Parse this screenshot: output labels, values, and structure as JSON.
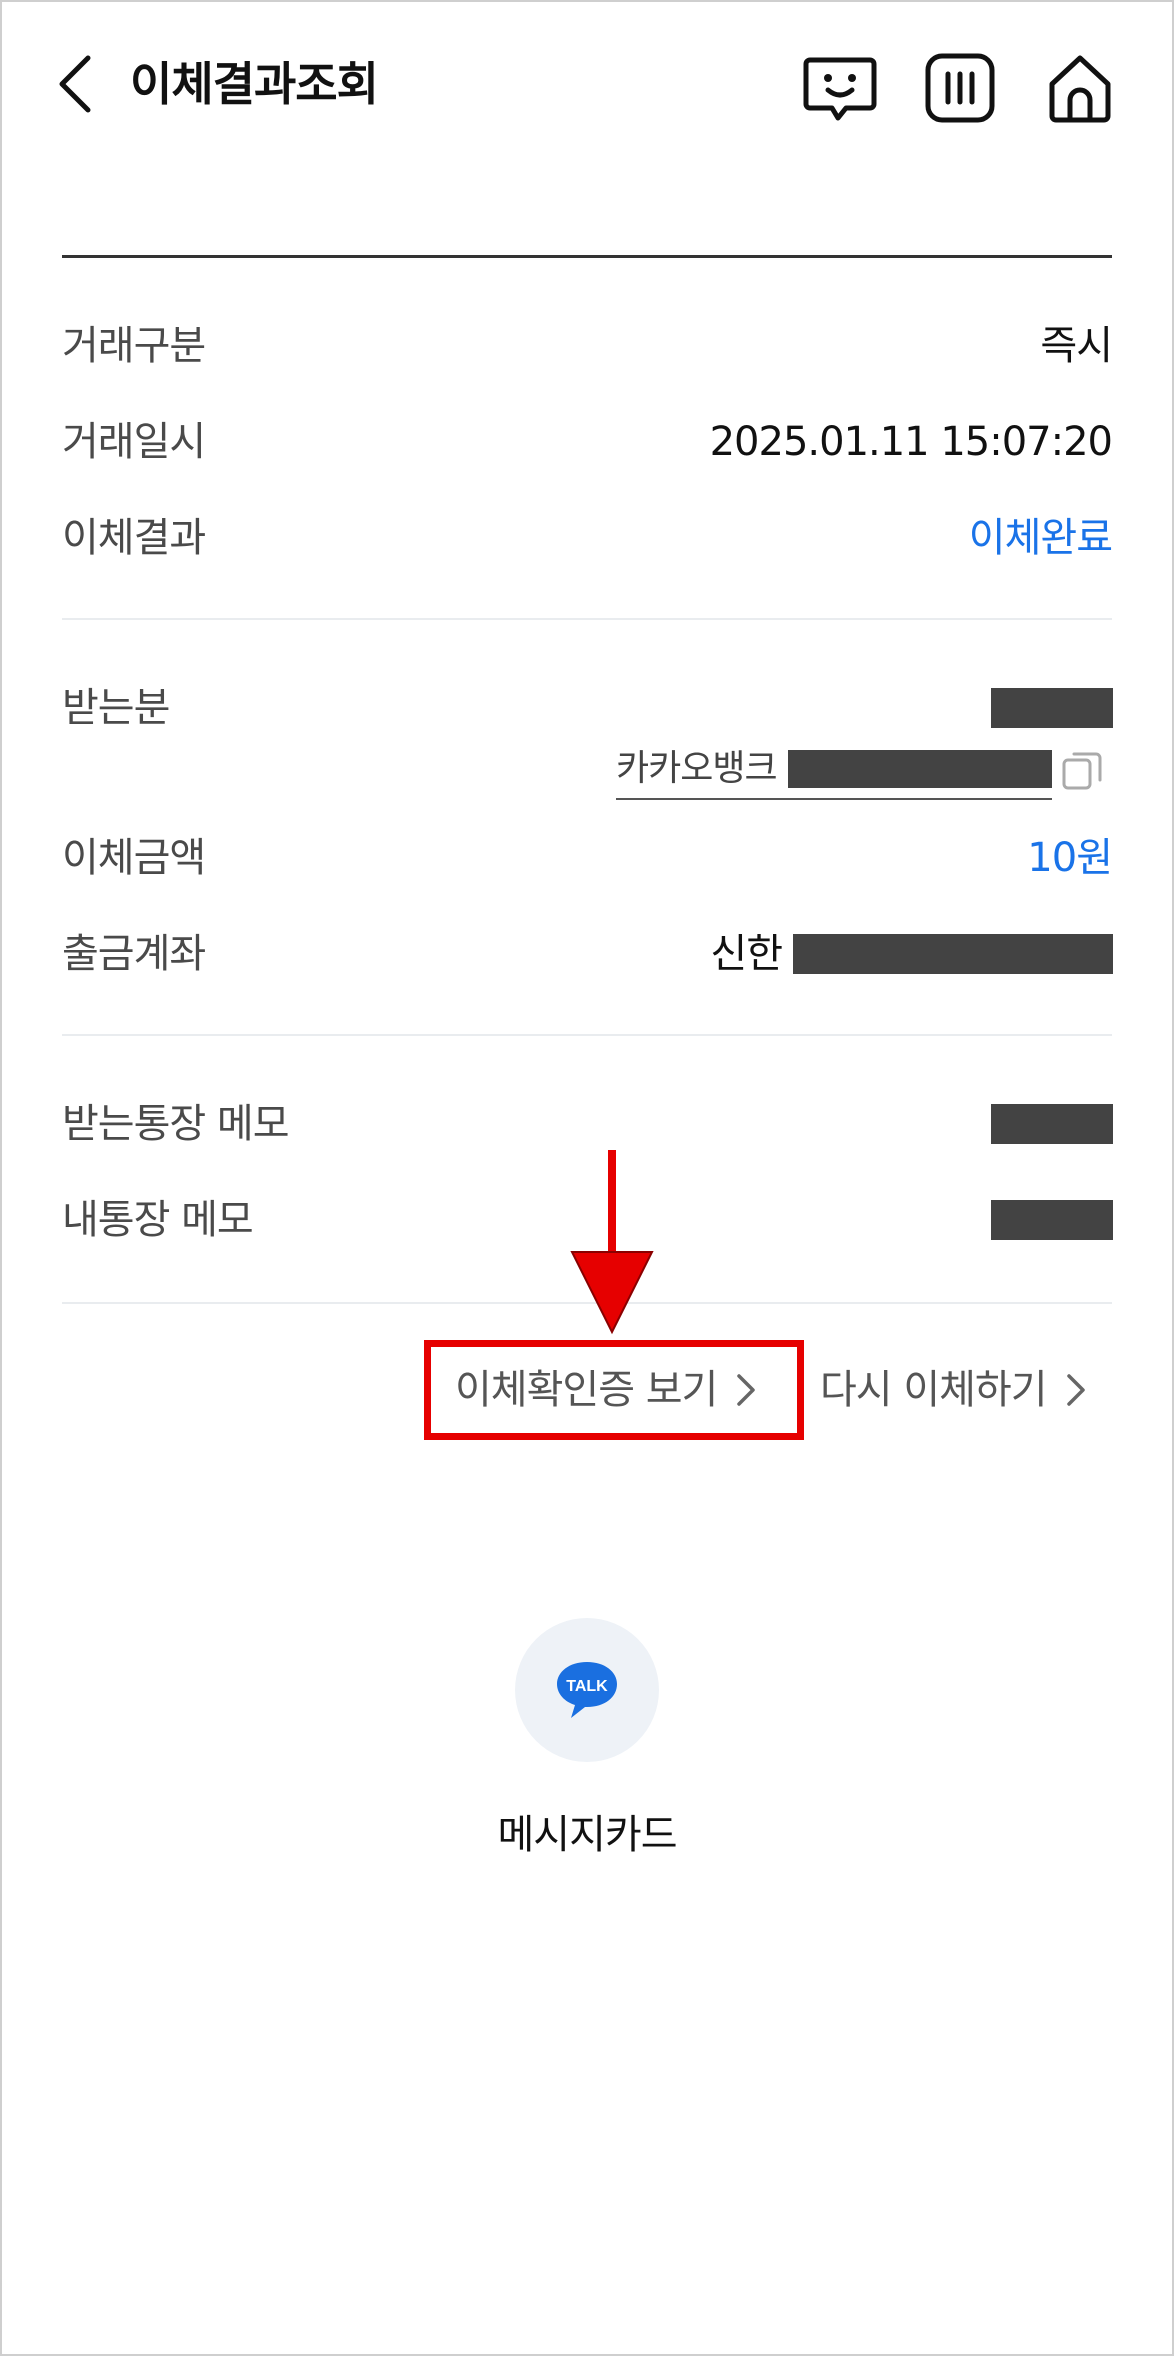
{
  "header": {
    "title": "이체결과조회",
    "icons": [
      "back-icon",
      "chat-bot-icon",
      "menu-icon",
      "home-icon"
    ]
  },
  "transaction": {
    "type_label": "거래구분",
    "type_value": "즉시",
    "datetime_label": "거래일시",
    "datetime_value": "2025.01.11 15:07:20",
    "result_label": "이체결과",
    "result_value": "이체완료"
  },
  "recipient": {
    "label": "받는분",
    "bank": "카카오뱅크",
    "amount_label": "이체금액",
    "amount_value": "10원",
    "from_account_label": "출금계좌",
    "from_bank": "신한"
  },
  "memo": {
    "recipient_memo_label": "받는통장 메모",
    "my_memo_label": "내통장 메모"
  },
  "actions": {
    "verify_label": "이체확인증 보기",
    "retransfer_label": "다시 이체하기"
  },
  "share": {
    "talk_badge": "TALK",
    "message_card_label": "메시지카드"
  },
  "colors": {
    "accent_blue": "#1a73e8",
    "redaction": "#434343",
    "highlight_red": "#e60000",
    "talk_blue": "#1a6fe0"
  }
}
